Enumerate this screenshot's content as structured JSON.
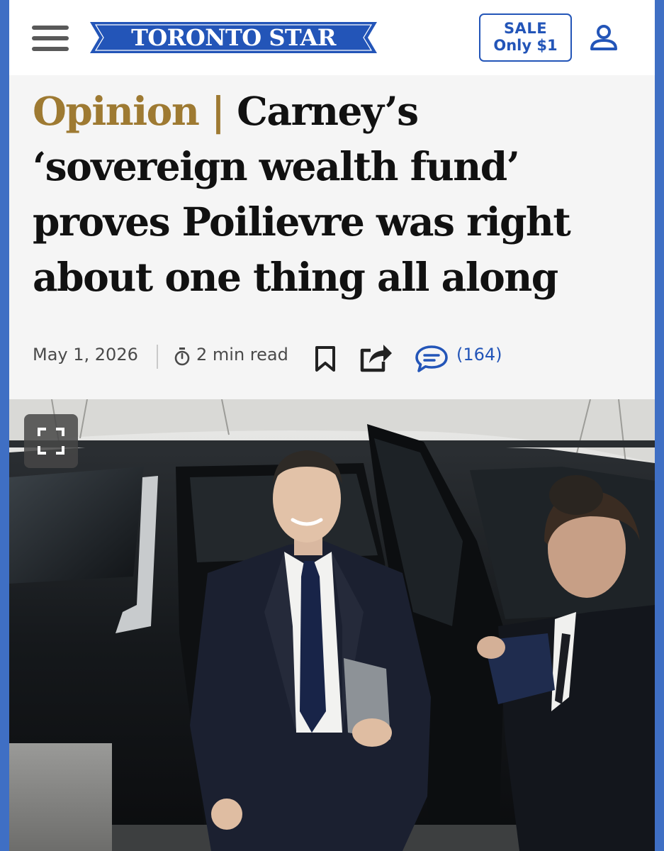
{
  "header": {
    "logo_text": "TORONTO STAR",
    "sale_line1": "SALE",
    "sale_line2": "Only $1",
    "menu_icon": "hamburger-menu-icon",
    "user_icon": "user-account-icon"
  },
  "article": {
    "kicker": "Opinion",
    "kicker_separator": "|",
    "title": "Carney’s ‘sovereign wealth fund’ proves Poilievre was right about one thing all along",
    "date": "May 1, 2026",
    "read_time": "2 min read",
    "comment_count": "(164)"
  },
  "icons": {
    "timer": "stopwatch-icon",
    "bookmark": "bookmark-icon",
    "share": "share-icon",
    "comments": "comment-bubble-icon",
    "expand": "fullscreen-expand-icon"
  },
  "colors": {
    "brand_blue": "#2355b8",
    "kicker_gold": "#9e7a32",
    "page_border": "#3f6fc4"
  }
}
